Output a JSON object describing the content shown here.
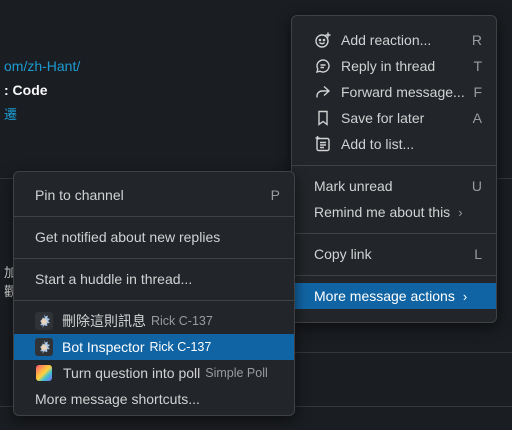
{
  "background": {
    "link_text": "om/zh-Hant/",
    "title_fragment": ": Code",
    "glyph_1": "遷",
    "glyph_2": "加",
    "glyph_3": "觀"
  },
  "message_menu": {
    "items": [
      {
        "label": "Add reaction...",
        "key": "R",
        "icon": "add-reaction-icon"
      },
      {
        "label": "Reply in thread",
        "key": "T",
        "icon": "thread-icon"
      },
      {
        "label": "Forward message...",
        "key": "F",
        "icon": "forward-icon"
      },
      {
        "label": "Save for later",
        "key": "A",
        "icon": "bookmark-icon"
      },
      {
        "label": "Add to list...",
        "icon": "add-to-list-icon"
      }
    ],
    "mark_unread": {
      "label": "Mark unread",
      "key": "U"
    },
    "remind_me": {
      "label": "Remind me about this",
      "chevron": "›"
    },
    "copy_link": {
      "label": "Copy link",
      "key": "L"
    },
    "more_actions": {
      "label": "More message actions",
      "chevron": "›"
    }
  },
  "more_actions_menu": {
    "pin": {
      "label": "Pin to channel",
      "key": "P"
    },
    "notify": {
      "label": "Get notified about new replies"
    },
    "huddle": {
      "label": "Start a huddle in thread..."
    },
    "shortcuts": [
      {
        "label": "刪除這則訊息",
        "app": "Rick C-137",
        "icon": "rick-avatar-icon"
      },
      {
        "label": "Bot Inspector",
        "app": "Rick C-137",
        "icon": "rick-avatar-icon",
        "active": true
      },
      {
        "label": "Turn question into poll",
        "app": "Simple Poll",
        "icon": "simple-poll-icon"
      }
    ],
    "more_shortcuts": {
      "label": "More message shortcuts..."
    }
  },
  "colors": {
    "accent": "#1164a3",
    "menu_bg": "#222529",
    "app_bg": "#1a1d21",
    "link": "#1d9bd1"
  }
}
